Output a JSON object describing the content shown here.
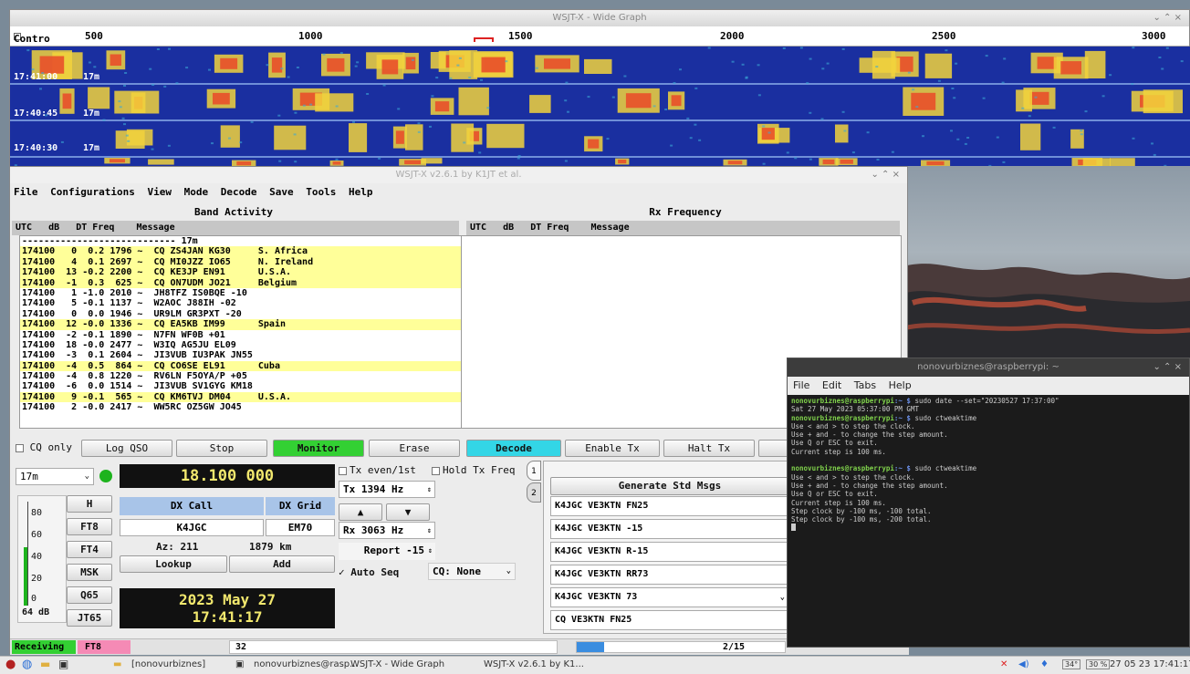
{
  "wide_graph": {
    "title": "WSJT-X - Wide Graph",
    "controls_label": "Contro",
    "scale_labels": [
      "500",
      "1000",
      "1500",
      "2000",
      "2500",
      "3000"
    ],
    "time_stamps": [
      "17:41:00",
      "17:40:45",
      "17:40:30"
    ],
    "band_marks": [
      "17m",
      "17m",
      "17m"
    ],
    "colors": {
      "background": "#1a2fa0",
      "signal_low": "#3aa9d6",
      "signal_mid": "#f2d23c",
      "signal_high": "#e8502a"
    }
  },
  "main_window": {
    "title": "WSJT-X  v2.6.1  by K1JT et al.",
    "menu": [
      "File",
      "Configurations",
      "View",
      "Mode",
      "Decode",
      "Save",
      "Tools",
      "Help"
    ],
    "band_activity": {
      "title": "Band Activity",
      "header": "UTC   dB   DT Freq    Message",
      "separator": "---------------------------- 17m",
      "rows": [
        {
          "text": "174100   0  0.2 1796 ~  CQ ZS4JAN KG30     S. Africa",
          "cq": true
        },
        {
          "text": "174100   4  0.1 2697 ~  CQ MI0JZZ IO65     N. Ireland",
          "cq": true
        },
        {
          "text": "174100  13 -0.2 2200 ~  CQ KE3JP EN91      U.S.A.",
          "cq": true
        },
        {
          "text": "174100  -1  0.3  625 ~  CQ ON7UDM JO21     Belgium",
          "cq": true
        },
        {
          "text": "174100   1 -1.0 2010 ~  JH8TFZ IS0BQE -10",
          "cq": false
        },
        {
          "text": "174100   5 -0.1 1137 ~  W2AOC J88IH -02",
          "cq": false
        },
        {
          "text": "174100   0  0.0 1946 ~  UR9LM GR3PXT -20",
          "cq": false
        },
        {
          "text": "174100  12 -0.0 1336 ~  CQ EA5KB IM99      Spain",
          "cq": true
        },
        {
          "text": "174100  -2 -0.1 1890 ~  N7FN WF0B +01",
          "cq": false
        },
        {
          "text": "174100  18 -0.0 2477 ~  W3IQ AG5JU EL09",
          "cq": false
        },
        {
          "text": "174100  -3  0.1 2604 ~  JI3VUB IU3PAK JN55",
          "cq": false
        },
        {
          "text": "174100  -4  0.5  864 ~  CQ CO6SE EL91      Cuba",
          "cq": true
        },
        {
          "text": "174100  -4  0.8 1220 ~  RV6LN F5OYA/P +05",
          "cq": false
        },
        {
          "text": "174100  -6  0.0 1514 ~  JI3VUB SV1GYG KM18",
          "cq": false
        },
        {
          "text": "174100   9 -0.1  565 ~  CQ KM6TVJ DM04     U.S.A.",
          "cq": true
        },
        {
          "text": "174100   2 -0.0 2417 ~  WW5RC OZ5GW JO45",
          "cq": false
        }
      ]
    },
    "rx_frequency": {
      "title": "Rx Frequency",
      "header": "UTC   dB   DT Freq    Message"
    },
    "buttons": {
      "cq_only": "CQ only",
      "log_qso": "Log QSO",
      "stop": "Stop",
      "monitor": "Monitor",
      "erase": "Erase",
      "decode": "Decode",
      "enable_tx": "Enable Tx",
      "halt_tx": "Halt Tx",
      "lookup": "Lookup",
      "add": "Add",
      "generate": "Generate Std Msgs"
    },
    "band": "17m",
    "frequency": "18.100 000",
    "signal_level": {
      "scale": [
        "80",
        "60",
        "40",
        "20",
        "0"
      ],
      "reading": "64 dB",
      "level_fraction": 0.64
    },
    "modes": [
      "H",
      "FT8",
      "FT4",
      "MSK",
      "Q65",
      "JT65"
    ],
    "dx_call_label": "DX Call",
    "dx_grid_label": "DX Grid",
    "dx_call": "K4JGC",
    "dx_grid": "EM70",
    "azimuth": "Az: 211",
    "distance": "1879 km",
    "date": "2023 May 27",
    "time": "17:41:17",
    "tx_even": "Tx even/1st",
    "hold_tx_freq": "Hold Tx Freq",
    "tx_freq": "Tx  1394  Hz",
    "rx_freq": "Rx  3063  Hz",
    "report": "Report -15",
    "auto_seq": "Auto Seq",
    "cq_select": "CQ: None",
    "messages": [
      "K4JGC VE3KTN FN25",
      "K4JGC VE3KTN -15",
      "K4JGC VE3KTN R-15",
      "K4JGC VE3KTN RR73",
      "K4JGC VE3KTN 73",
      "CQ VE3KTN FN25"
    ],
    "tab_labels": [
      "1",
      "2"
    ],
    "status": {
      "receiving": "Receiving",
      "mode": "FT8",
      "count": "32",
      "progress_text": "2/15",
      "progress_fraction": 0.133
    },
    "colors": {
      "monitor": "#33d033",
      "decode": "#33d6e6",
      "cq_row": "#ffff99",
      "display_bg": "#111111",
      "display_fg": "#f2e86e",
      "dx_header": "#a8c4e8"
    }
  },
  "terminal": {
    "title": "nonovurbiznes@raspberrypi: ~",
    "menu": [
      "File",
      "Edit",
      "Tabs",
      "Help"
    ],
    "lines": [
      {
        "prompt": "nonovurbiznes@raspberrypi",
        "path": ":~ $",
        "text": " sudo date --set=\"20230527 17:37:00\""
      },
      {
        "text": "Sat 27 May 2023 05:37:00 PM GMT"
      },
      {
        "prompt": "nonovurbiznes@raspberrypi",
        "path": ":~ $",
        "text": " sudo ctweaktime"
      },
      {
        "text": "Use < and > to step the clock."
      },
      {
        "text": "Use + and - to change the step amount."
      },
      {
        "text": "Use Q or ESC to exit."
      },
      {
        "text": "Current step is 100 ms."
      },
      {
        "text": ""
      },
      {
        "prompt": "nonovurbiznes@raspberrypi",
        "path": ":~ $",
        "text": " sudo ctweaktime"
      },
      {
        "text": "Use < and > to step the clock."
      },
      {
        "text": "Use + and - to change the step amount."
      },
      {
        "text": "Use Q or ESC to exit."
      },
      {
        "text": "Current step is 100 ms."
      },
      {
        "text": "Step clock by -100 ms, -100 total."
      },
      {
        "text": "Step clock by -100 ms, -200 total."
      }
    ]
  },
  "taskbar": {
    "items": [
      "[nonovurbiznes]",
      "nonovurbiznes@rasp...",
      "WSJT-X - Wide Graph",
      "WSJT-X  v2.6.1  by K1..."
    ],
    "cpu": "34°",
    "net": "30 %",
    "clock": "27 05 23  17:41:17"
  }
}
